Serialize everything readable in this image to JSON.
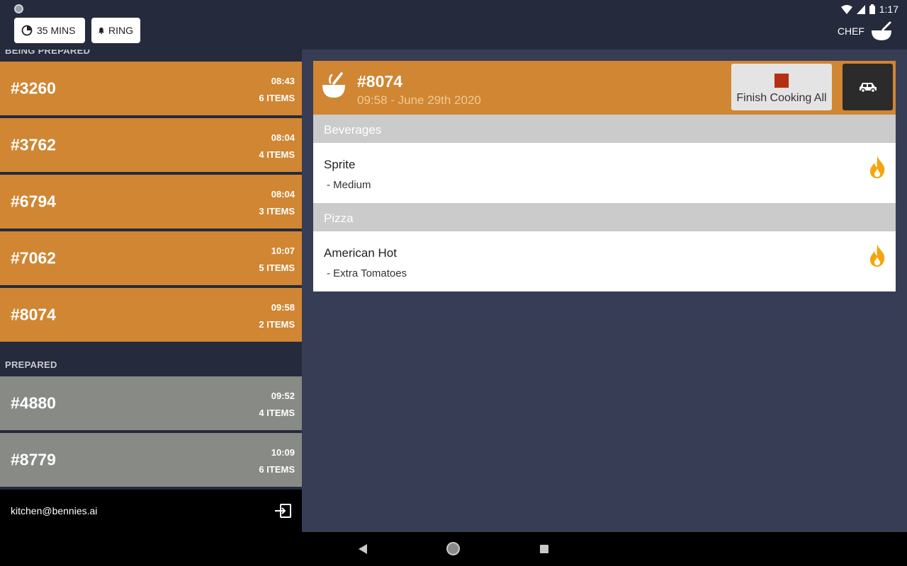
{
  "status_bar": {
    "time": "1:17"
  },
  "toolbar": {
    "timer_label": "35 MINS",
    "ring_label": "RING",
    "chef_label": "CHEF"
  },
  "sections": {
    "being_prepared": "BEING PREPARED",
    "prepared": "PREPARED"
  },
  "being_prepared_orders": [
    {
      "number": "#3260",
      "time": "08:43",
      "items": "6 ITEMS"
    },
    {
      "number": "#3762",
      "time": "08:04",
      "items": "4 ITEMS"
    },
    {
      "number": "#6794",
      "time": "08:04",
      "items": "3 ITEMS"
    },
    {
      "number": "#7062",
      "time": "10:07",
      "items": "5 ITEMS"
    },
    {
      "number": "#8074",
      "time": "09:58",
      "items": "2 ITEMS"
    }
  ],
  "prepared_orders": [
    {
      "number": "#4880",
      "time": "09:52",
      "items": "4 ITEMS"
    },
    {
      "number": "#8779",
      "time": "10:09",
      "items": "6 ITEMS"
    }
  ],
  "account": {
    "email": "kitchen@bennies.ai"
  },
  "order_detail": {
    "number": "#8074",
    "datetime": "09:58 - June 29th 2020",
    "finish_label": "Finish Cooking All",
    "categories": [
      {
        "name": "Beverages",
        "items": [
          {
            "name": "Sprite",
            "modifier": "- Medium"
          }
        ]
      },
      {
        "name": "Pizza",
        "items": [
          {
            "name": "American Hot",
            "modifier": "- Extra Tomatoes"
          }
        ]
      }
    ]
  },
  "colors": {
    "orange": "#d08633",
    "grey_card": "#878a85",
    "panel_bg": "#373d55",
    "dark_bg": "#252a3c",
    "flame": "#f5a50c",
    "stop": "#b52f12"
  },
  "icons": [
    "timer-icon",
    "bell-icon",
    "chef-bowl-icon",
    "wifi-icon",
    "signal-icon",
    "battery-icon",
    "logout-icon",
    "delivery-car-icon",
    "flame-icon"
  ]
}
